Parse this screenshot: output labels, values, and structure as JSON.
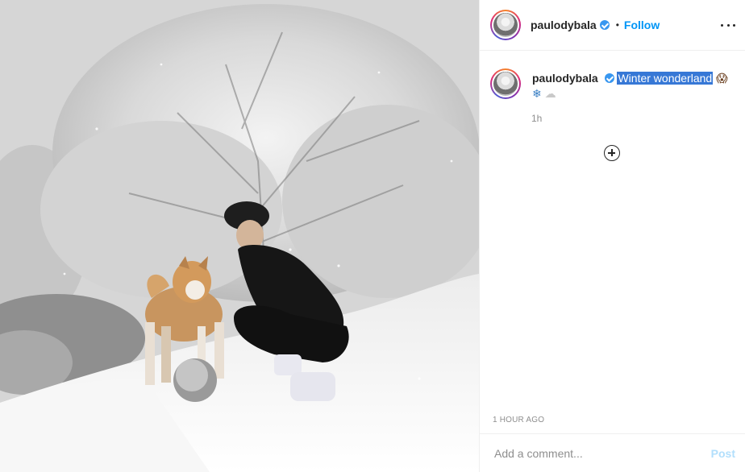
{
  "photo": {
    "alt": "Man crouching in snow next to an Akita dog and a snow-covered ball"
  },
  "header": {
    "username": "paulodybala",
    "separator": "•",
    "follow_label": "Follow"
  },
  "caption": {
    "username": "paulodybala",
    "text": "Winter wonderland",
    "emojis": [
      "😱",
      "❄",
      "☁"
    ],
    "age": "1h"
  },
  "post": {
    "time_label": "1 HOUR AGO"
  },
  "comment_box": {
    "placeholder": "Add a comment...",
    "post_label": "Post"
  },
  "colors": {
    "accent": "#0095f6",
    "verified": "#3897f0",
    "selection": "#3778d6",
    "muted": "#8e8e8e"
  },
  "icons": {
    "more": "more-horizontal-icon",
    "verified": "verified-badge-icon",
    "load_more": "plus-circle-icon"
  }
}
